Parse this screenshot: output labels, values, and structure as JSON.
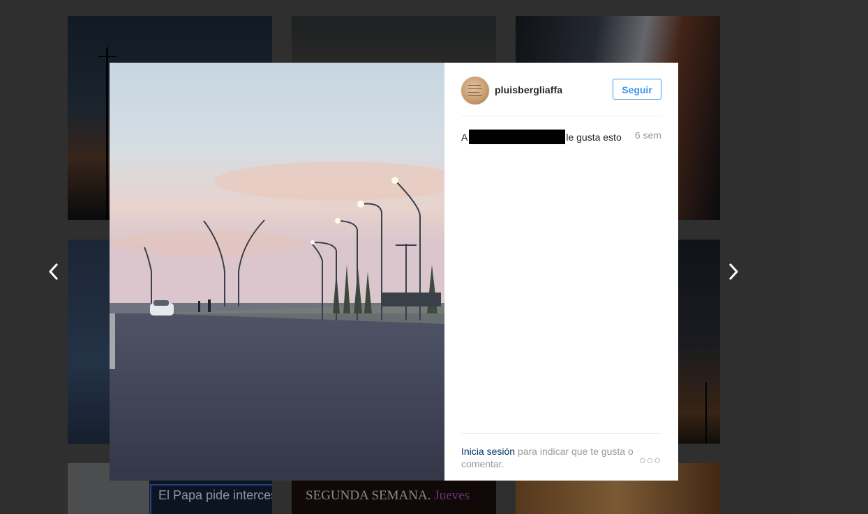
{
  "background_grid": {
    "tile_7_text": "El Papa pide intercesión de M",
    "tile_8_text_a": "SEGUNDA SEMANA.",
    "tile_8_text_b": "Jueves"
  },
  "nav": {
    "prev_icon": "chevron-left-icon",
    "next_icon": "chevron-right-icon"
  },
  "post": {
    "username": "pluisbergliaffa",
    "follow_label": "Seguir",
    "likes_prefix": "A",
    "likes_suffix": "le gusta esto",
    "time": "6 sem",
    "login_link": "Inicia sesión",
    "login_rest": " para indicar que te gusta o comentar.",
    "more_label": "○○○"
  },
  "colors": {
    "accent": "#3897f0",
    "link": "#003569",
    "muted": "#999999"
  }
}
